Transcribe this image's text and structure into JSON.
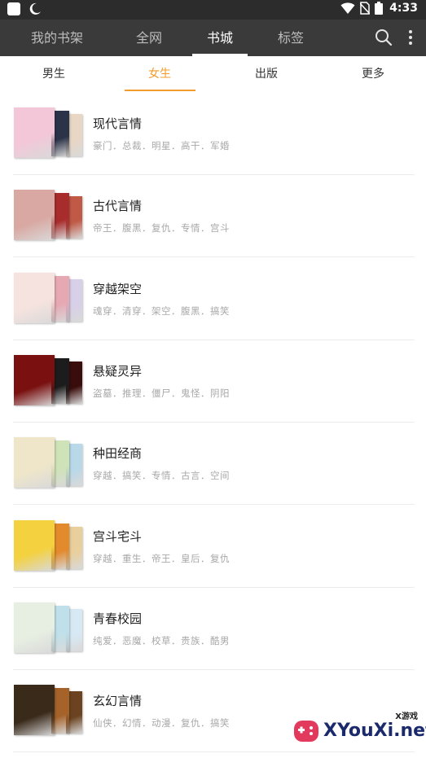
{
  "status_bar": {
    "time": "4:33"
  },
  "app_bar": {
    "tabs": [
      {
        "label": "我的书架"
      },
      {
        "label": "全网"
      },
      {
        "label": "书城"
      },
      {
        "label": "标签"
      }
    ],
    "active_tab": "书城"
  },
  "sub_tabs": {
    "items": [
      {
        "label": "男生"
      },
      {
        "label": "女生"
      },
      {
        "label": "出版"
      },
      {
        "label": "更多"
      }
    ],
    "active": "女生",
    "accent_color": "#f39c2b"
  },
  "categories": [
    {
      "title": "现代言情",
      "tags": "豪门．总裁．明星．高干．军婚",
      "covers": [
        "#f3c7d8",
        "#2b3348",
        "#e9d6c4"
      ]
    },
    {
      "title": "古代言情",
      "tags": "帝王．腹黑．复仇．专情．宫斗",
      "covers": [
        "#d9a8a2",
        "#a82c2c",
        "#c05a47"
      ]
    },
    {
      "title": "穿越架空",
      "tags": "魂穿．清穿．架空．腹黑．搞笑",
      "covers": [
        "#f6e3df",
        "#e6a8b3",
        "#d8cfe8"
      ]
    },
    {
      "title": "悬疑灵异",
      "tags": "盗墓．推理．僵尸．鬼怪．阴阳",
      "covers": [
        "#7a1010",
        "#1c1c1c",
        "#3a0d0d"
      ]
    },
    {
      "title": "种田经商",
      "tags": "穿越．搞笑．专情．古言．空间",
      "covers": [
        "#efe6c9",
        "#cfe3b8",
        "#b9d8e8"
      ]
    },
    {
      "title": "宫斗宅斗",
      "tags": "穿越．重生．帝王．皇后．复仇",
      "covers": [
        "#f4d13e",
        "#e28a2c",
        "#e9cf9c"
      ]
    },
    {
      "title": "青春校园",
      "tags": "纯爱．恶魔．校草．贵族．酷男",
      "covers": [
        "#e7efe2",
        "#bfe0ea",
        "#d7e9f4"
      ]
    },
    {
      "title": "玄幻言情",
      "tags": "仙侠．幻情．动漫．复仇．搞笑",
      "covers": [
        "#3a2a1a",
        "#a5632a",
        "#6b4320"
      ]
    }
  ],
  "watermark": {
    "text": "XYouXi.net",
    "sub": "X游戏"
  },
  "icons": [
    "app-icon",
    "moon-icon",
    "wifi-icon",
    "no-sim-icon",
    "battery-icon",
    "search-icon",
    "more-vert-icon"
  ]
}
